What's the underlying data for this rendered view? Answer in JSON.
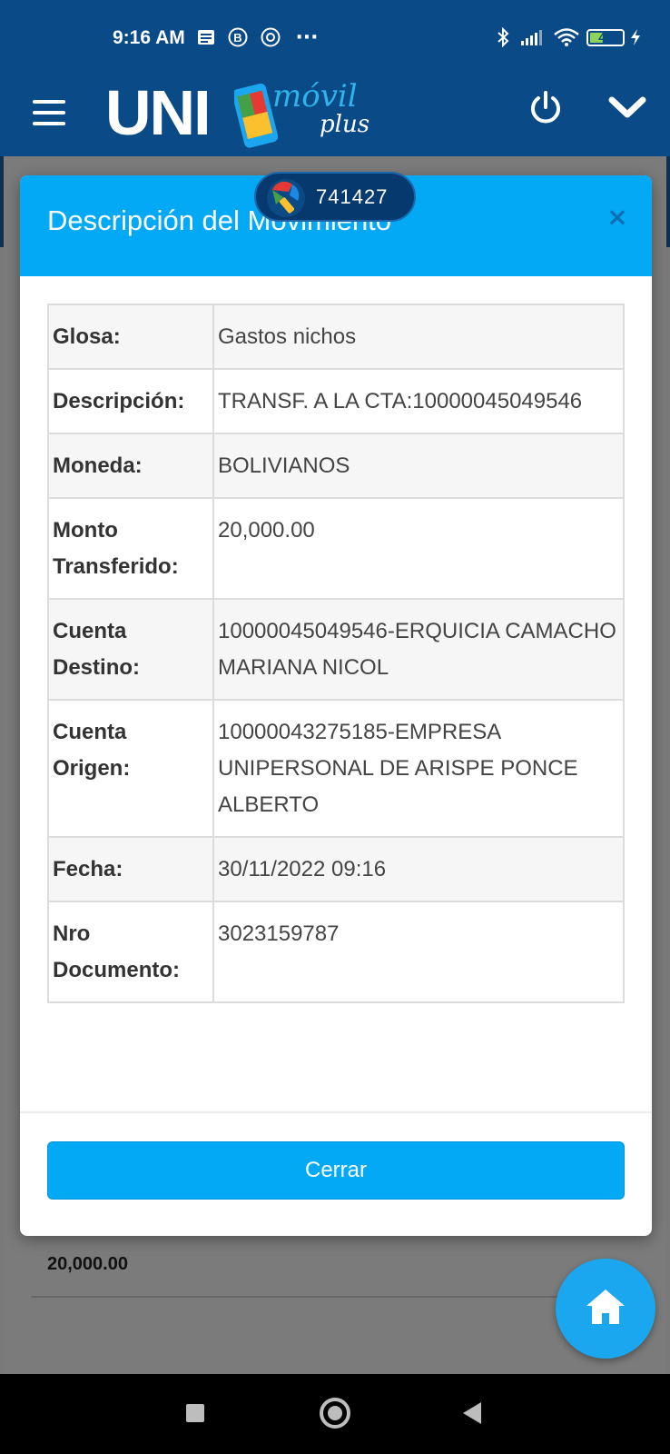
{
  "status_bar": {
    "time": "9:16 AM",
    "icons": [
      "notes-icon",
      "b-badge-icon",
      "chrome-icon",
      "more-dots-icon",
      "bluetooth-icon",
      "signal-icon",
      "wifi-icon",
      "battery-icon",
      "charging-icon"
    ],
    "more_dots": "···",
    "battery_level": "42",
    "battery_fraction": 0.42
  },
  "app_bar": {
    "logo_main": "UNI",
    "logo_script": "móvil",
    "logo_sub": "plus",
    "icons": [
      "menu-icon",
      "power-icon",
      "chevron-down-icon"
    ]
  },
  "background": {
    "amount": "20,000.00"
  },
  "otp_bubble": {
    "code": "741427",
    "icon": "key-icon"
  },
  "modal": {
    "title": "Descripción del Movimiento",
    "close_symbol": "×",
    "rows": [
      {
        "label": "Glosa:",
        "value": "Gastos nichos"
      },
      {
        "label": "Descripción:",
        "value": "TRANSF. A LA CTA:10000045049546"
      },
      {
        "label": "Moneda:",
        "value": "BOLIVIANOS"
      },
      {
        "label": "Monto Transferido:",
        "value": "20,000.00"
      },
      {
        "label": "Cuenta Destino:",
        "value": "10000045049546-ERQUICIA CAMACHO MARIANA NICOL"
      },
      {
        "label": "Cuenta Origen:",
        "value": "10000043275185-EMPRESA UNIPERSONAL DE ARISPE PONCE ALBERTO"
      },
      {
        "label": "Fecha:",
        "value": "30/11/2022 09:16"
      },
      {
        "label": "Nro Documento:",
        "value": "3023159787"
      }
    ],
    "close_button_label": "Cerrar"
  },
  "fab": {
    "icon": "home-icon"
  },
  "nav_bar": {
    "icons": [
      "recent-apps-icon",
      "home-nav-icon",
      "back-icon"
    ]
  },
  "colors": {
    "header_blue": "#0a4a86",
    "modal_accent": "#03a9f4",
    "fab": "#1aa7ef"
  }
}
